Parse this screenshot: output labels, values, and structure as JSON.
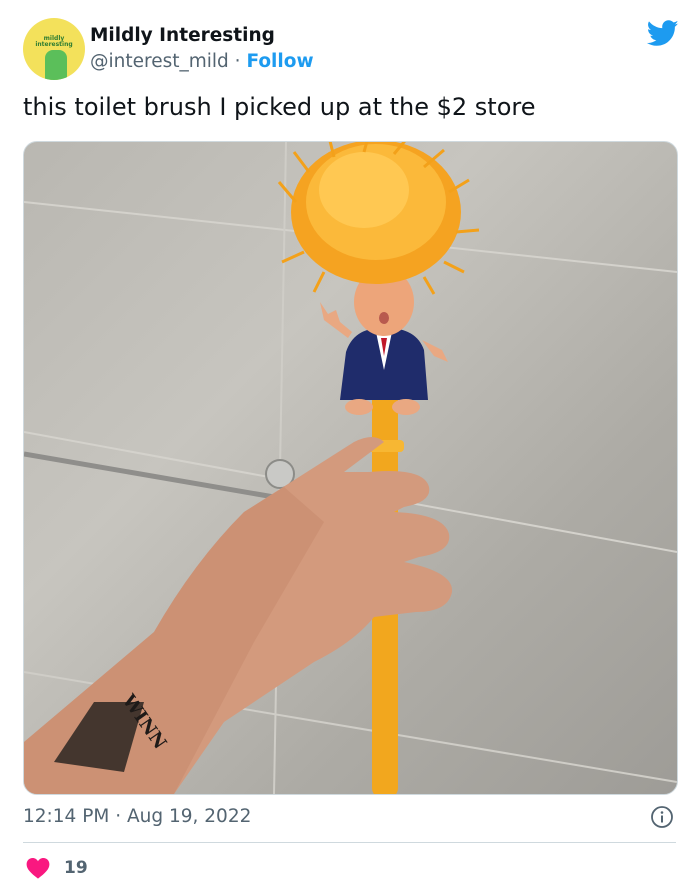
{
  "tweet": {
    "author_name": "Mildly Interesting",
    "author_handle": "@interest_mild",
    "separator": "·",
    "follow_label": "Follow",
    "avatar_text": "mildly interesting",
    "text": "this toilet brush I picked up at the $2 store",
    "time": "12:14 PM",
    "date": "Aug 19, 2022",
    "like_count": "19",
    "tattoo_text": "WINN"
  },
  "colors": {
    "accent": "#1d9bf0",
    "heart": "#f91880",
    "muted": "#536471"
  },
  "icons": [
    "twitter-bird-icon",
    "info-icon",
    "heart-icon"
  ]
}
